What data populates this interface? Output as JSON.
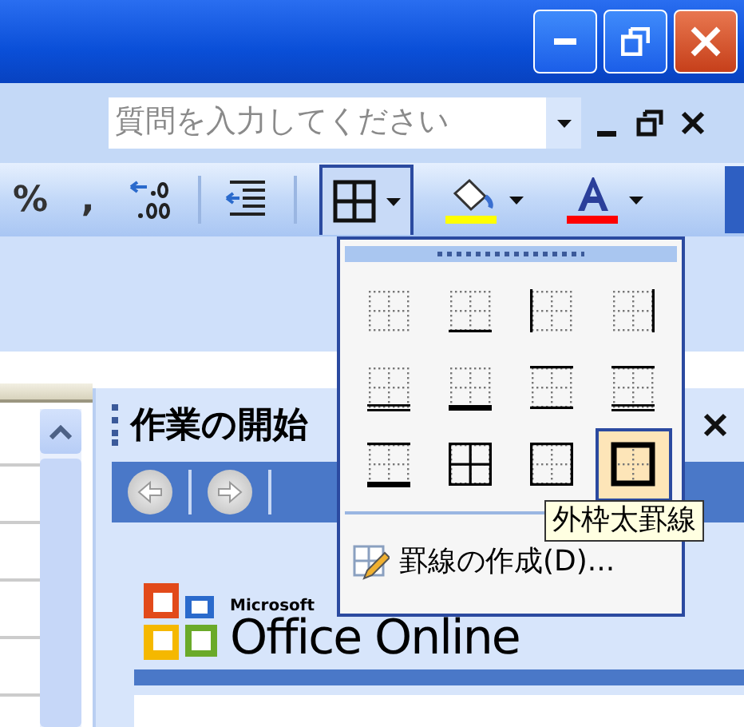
{
  "question_box": {
    "placeholder": "質問を入力してください"
  },
  "toolbar": {
    "items": [
      {
        "kind": "text",
        "label": "%"
      },
      {
        "kind": "text",
        "label": ","
      },
      {
        "kind": "decimal"
      },
      {
        "kind": "indent"
      },
      {
        "kind": "borders",
        "pressed": true
      },
      {
        "kind": "fill"
      },
      {
        "kind": "font-color"
      }
    ]
  },
  "borders_menu": {
    "styles": [
      {
        "kind": "none",
        "selected": false
      },
      {
        "kind": "bottom",
        "selected": false
      },
      {
        "kind": "left",
        "selected": false
      },
      {
        "kind": "right",
        "selected": false
      },
      {
        "kind": "double-bottom",
        "selected": false
      },
      {
        "kind": "thick-bottom",
        "selected": false
      },
      {
        "kind": "top-bottom",
        "selected": false
      },
      {
        "kind": "top-double-bottom",
        "selected": false
      },
      {
        "kind": "top-thick-bottom",
        "selected": false
      },
      {
        "kind": "all",
        "selected": false
      },
      {
        "kind": "outside",
        "selected": false
      },
      {
        "kind": "thick-outside",
        "selected": true
      }
    ],
    "draw_item": "罫線の作成(D)...",
    "tooltip": "外枠太罫線"
  },
  "task_pane": {
    "title": "作業の開始",
    "logo_small": "Microsoft",
    "logo_text": "Office Online"
  }
}
